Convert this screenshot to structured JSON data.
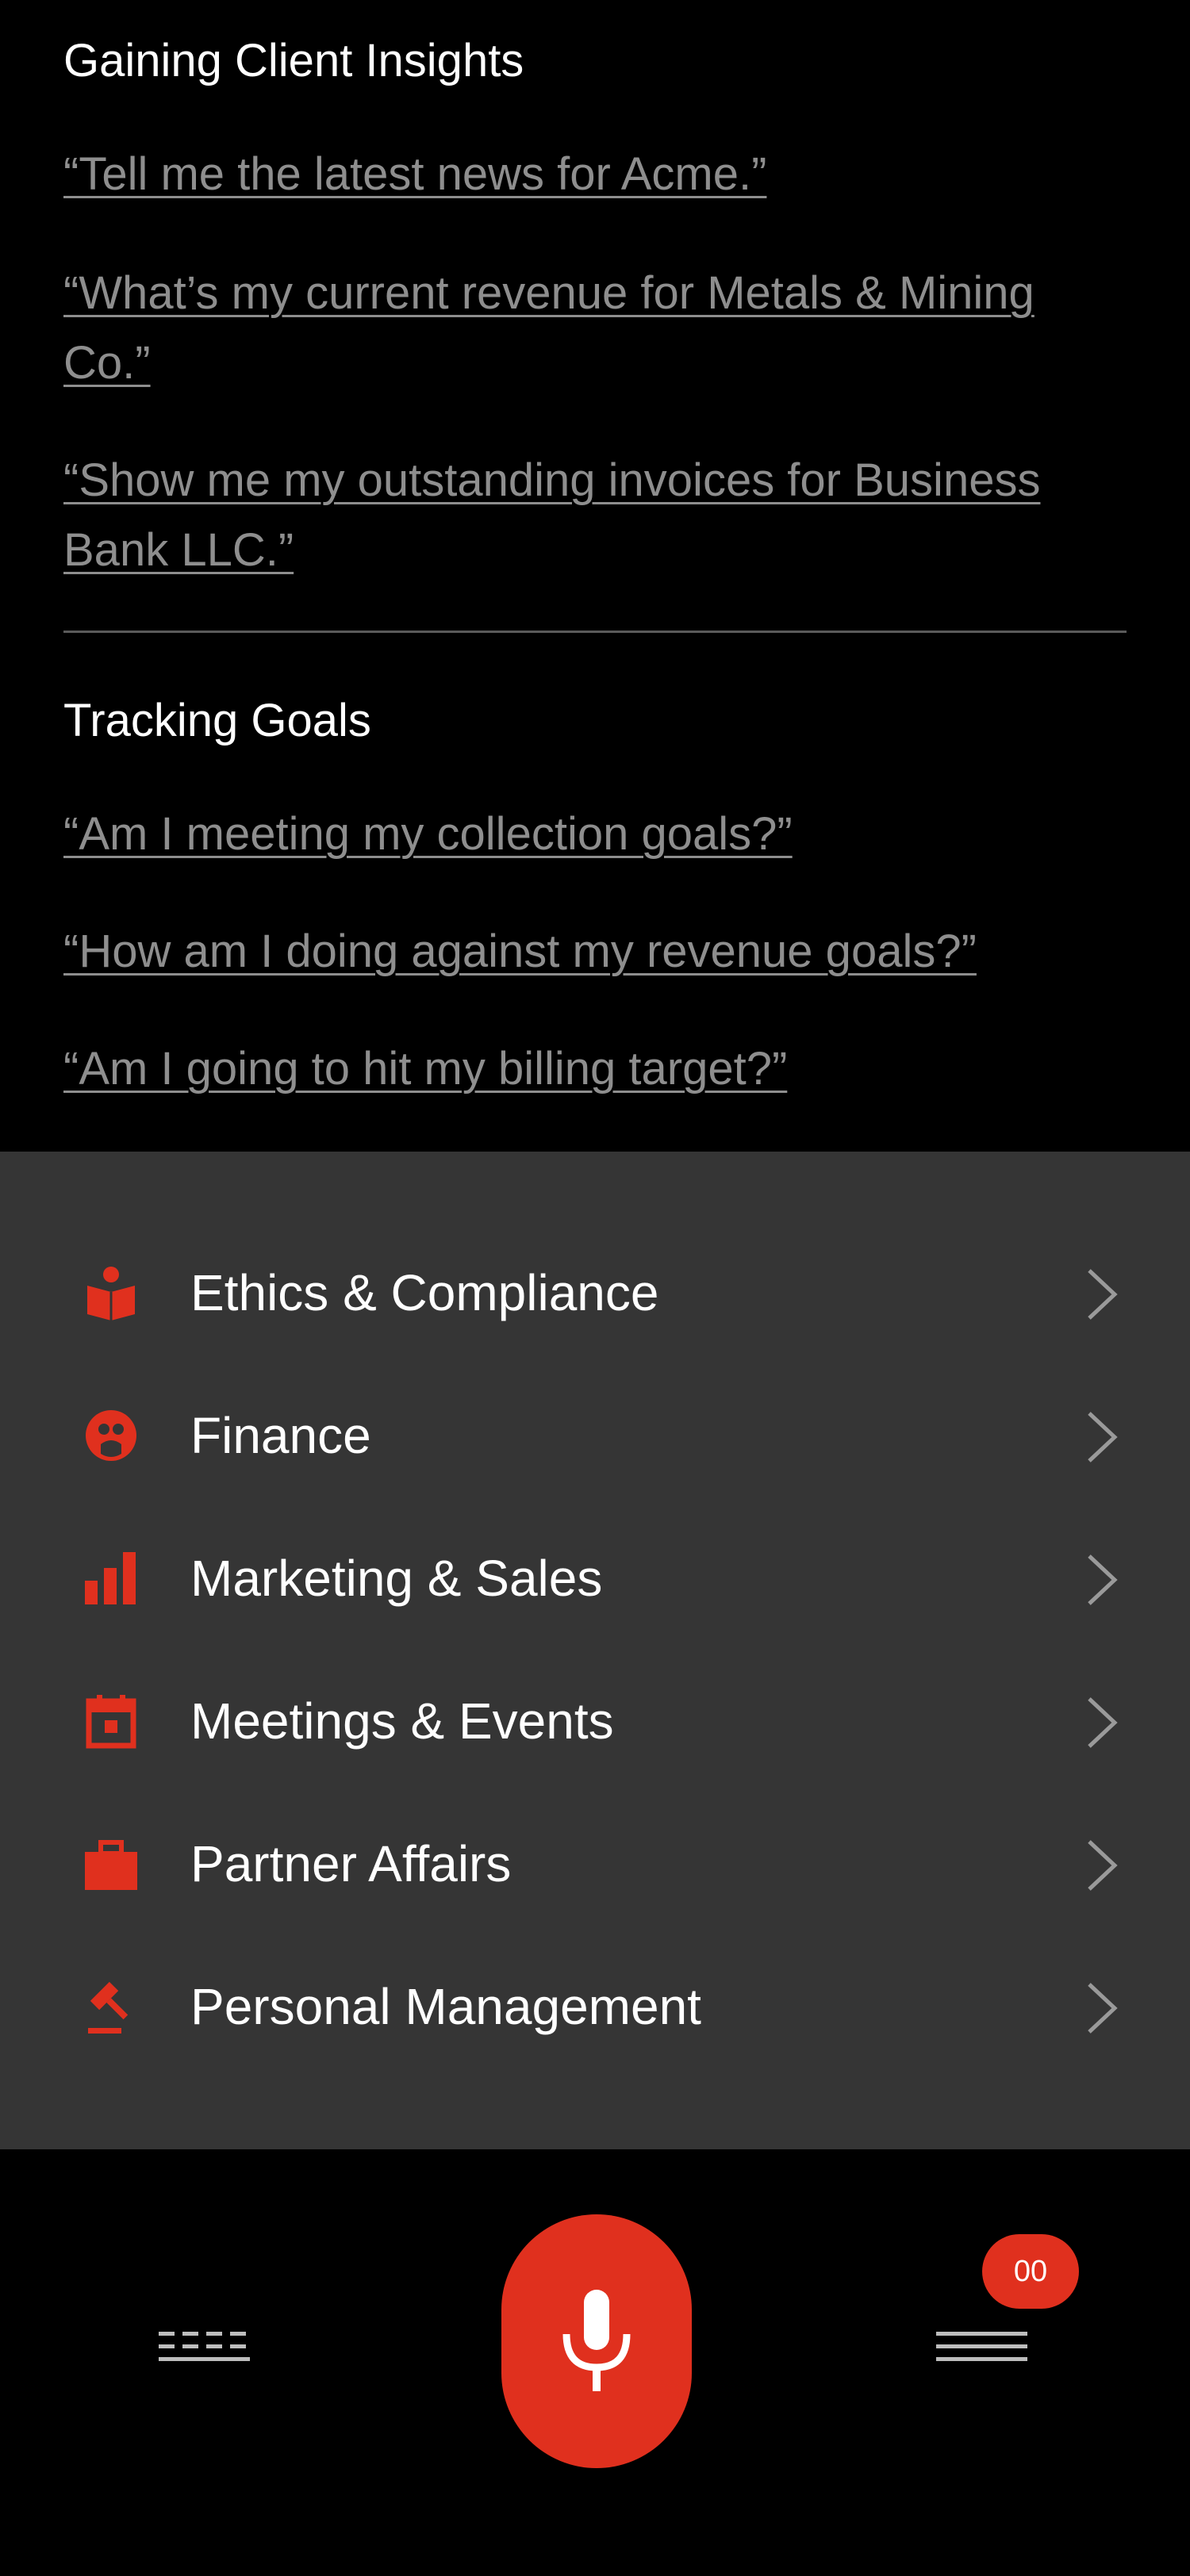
{
  "sections": [
    {
      "title": "Gaining Client Insights",
      "prompts": [
        "“Tell me the latest news for Acme.”",
        "“What’s my current revenue for Metals & Mining Co.”",
        "“Show me my outstanding invoices for Business Bank LLC.”"
      ]
    },
    {
      "title": "Tracking Goals",
      "prompts": [
        "“Am I meeting my collection goals?”",
        "“How am I doing against my revenue goals?”",
        "“Am I going to hit my billing target?”"
      ]
    }
  ],
  "menu": {
    "items": [
      {
        "label": "Ethics & Compliance",
        "icon": "ethics-book-icon"
      },
      {
        "label": "Finance",
        "icon": "finance-icon"
      },
      {
        "label": "Marketing & Sales",
        "icon": "bar-chart-icon"
      },
      {
        "label": "Meetings & Events",
        "icon": "calendar-icon"
      },
      {
        "label": "Partner Affairs",
        "icon": "briefcase-icon"
      },
      {
        "label": "Personal Management",
        "icon": "gavel-icon"
      }
    ]
  },
  "bottom_bar": {
    "badge_count": "00",
    "keyboard_icon": "keyboard-icon",
    "mic_icon": "microphone-icon",
    "list_icon": "list-icon"
  },
  "colors": {
    "accent": "#e0301e",
    "panel": "#353535",
    "background": "#000000",
    "prompt_text": "#8e8e8e"
  }
}
